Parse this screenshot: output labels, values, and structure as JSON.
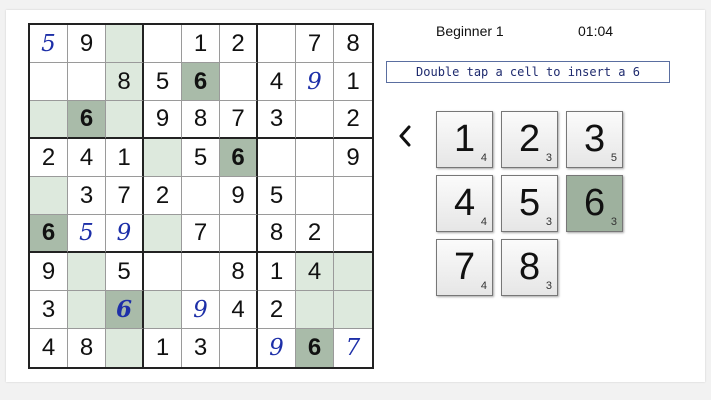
{
  "header": {
    "level": "Beginner 1",
    "timer": "01:04",
    "hint": "Double tap a cell to insert a 6"
  },
  "back_icon": "chevron-left-icon",
  "colors": {
    "highlight": "#dde9dd",
    "selected": "#a9bba9",
    "user_digit": "#1d2fa8"
  },
  "selected_number": "6",
  "grid": [
    [
      "5",
      "9",
      "",
      "",
      "1",
      "2",
      "",
      "7",
      "8"
    ],
    [
      "",
      "",
      "8",
      "5",
      "6",
      "",
      "4",
      "9",
      "1"
    ],
    [
      "",
      "6",
      "",
      "9",
      "8",
      "7",
      "3",
      "",
      "2"
    ],
    [
      "2",
      "4",
      "1",
      "",
      "5",
      "6",
      "",
      "",
      "9"
    ],
    [
      "",
      "3",
      "7",
      "2",
      "",
      "9",
      "5",
      "",
      ""
    ],
    [
      "6",
      "5",
      "9",
      "",
      "7",
      "",
      "8",
      "2",
      ""
    ],
    [
      "9",
      "",
      "5",
      "",
      "",
      "8",
      "1",
      "4",
      ""
    ],
    [
      "3",
      "",
      "6",
      "",
      "9",
      "4",
      "2",
      "",
      ""
    ],
    [
      "4",
      "8",
      "",
      "1",
      "3",
      "",
      "9",
      "6",
      "7"
    ]
  ],
  "user_entered": [
    [
      0,
      0
    ],
    [
      1,
      7
    ],
    [
      5,
      1
    ],
    [
      5,
      2
    ],
    [
      7,
      2
    ],
    [
      7,
      4
    ],
    [
      8,
      6
    ],
    [
      8,
      8
    ]
  ],
  "highlighted": [
    [
      0,
      2
    ],
    [
      1,
      2
    ],
    [
      2,
      0
    ],
    [
      2,
      2
    ],
    [
      3,
      3
    ],
    [
      4,
      0
    ],
    [
      5,
      3
    ],
    [
      6,
      1
    ],
    [
      6,
      7
    ],
    [
      6,
      8
    ],
    [
      7,
      1
    ],
    [
      7,
      3
    ],
    [
      7,
      7
    ],
    [
      7,
      8
    ],
    [
      8,
      2
    ]
  ],
  "selected_cells": [
    [
      1,
      4
    ],
    [
      2,
      1
    ],
    [
      3,
      5
    ],
    [
      5,
      0
    ],
    [
      7,
      2
    ],
    [
      8,
      7
    ]
  ],
  "keypad": [
    {
      "num": "1",
      "count": "4"
    },
    {
      "num": "2",
      "count": "3"
    },
    {
      "num": "3",
      "count": "5"
    },
    {
      "num": "4",
      "count": "4"
    },
    {
      "num": "5",
      "count": "3"
    },
    {
      "num": "6",
      "count": "3"
    },
    {
      "num": "7",
      "count": "4"
    },
    {
      "num": "8",
      "count": "3"
    }
  ]
}
